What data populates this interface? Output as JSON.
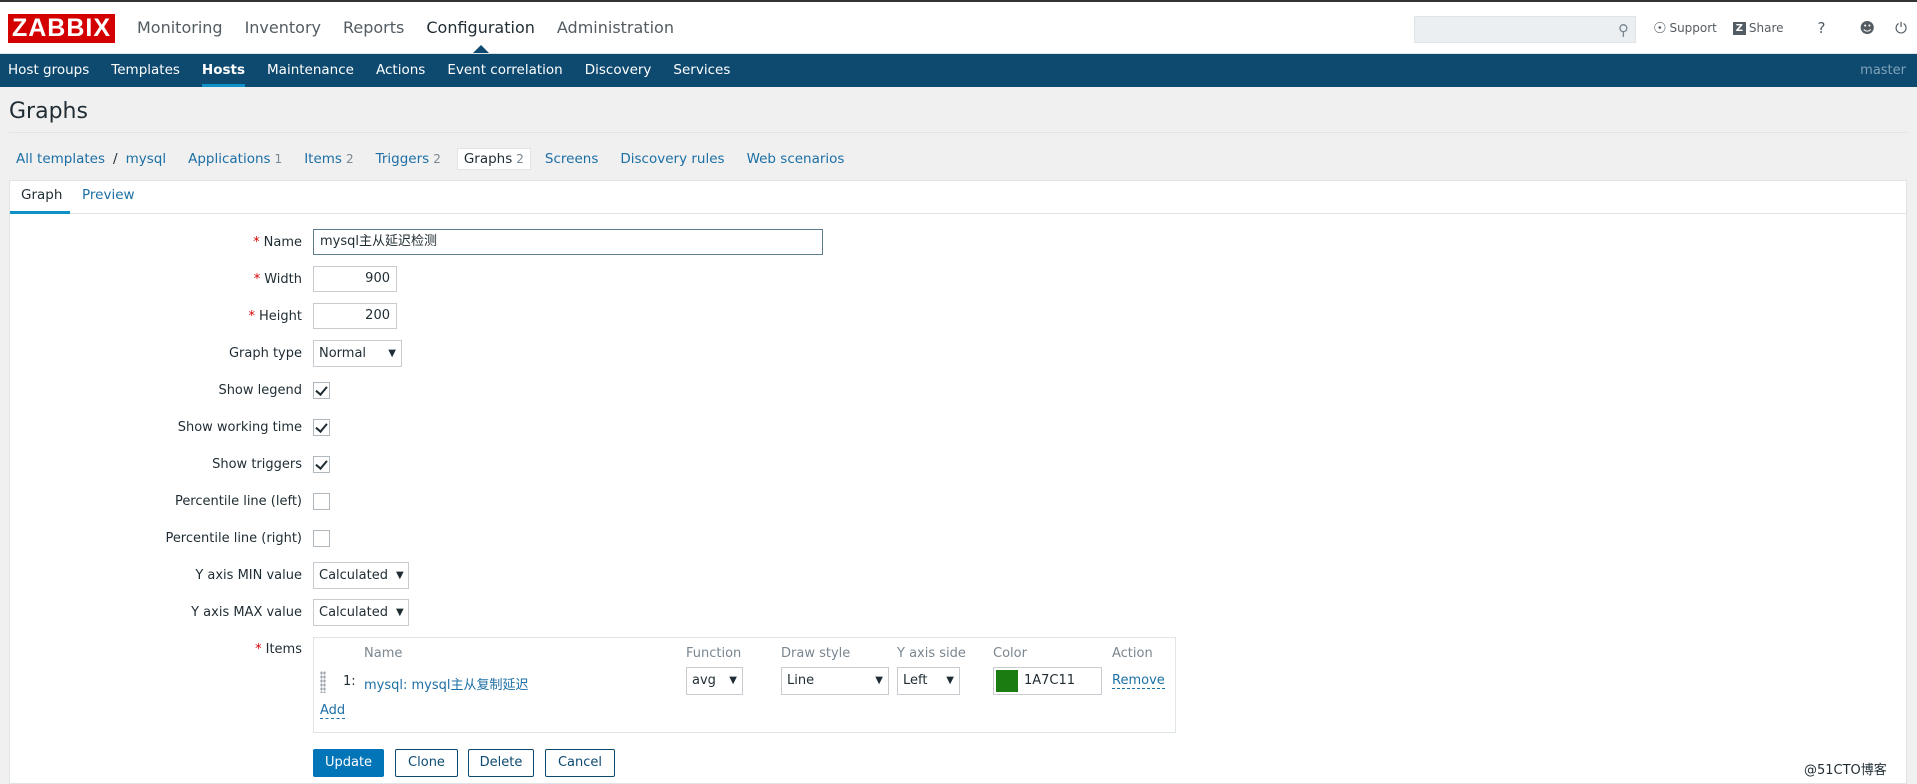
{
  "brand": {
    "logo": "ZABBIX",
    "accent": "#d40000",
    "nav_bg": "#0e4a70"
  },
  "main_menu": [
    "Monitoring",
    "Inventory",
    "Reports",
    "Configuration",
    "Administration"
  ],
  "top_links": {
    "support": "Support",
    "share": "Share",
    "help": "?"
  },
  "sub_menu": [
    "Host groups",
    "Templates",
    "Hosts",
    "Maintenance",
    "Actions",
    "Event correlation",
    "Discovery",
    "Services"
  ],
  "server_name": "master",
  "page_title": "Graphs",
  "breadcrumbs": {
    "all_templates": "All templates",
    "separator": "/",
    "host": "mysql",
    "applications": {
      "label": "Applications",
      "count": "1"
    },
    "items": {
      "label": "Items",
      "count": "2"
    },
    "triggers": {
      "label": "Triggers",
      "count": "2"
    },
    "graphs": {
      "label": "Graphs",
      "count": "2"
    },
    "screens": "Screens",
    "discovery_rules": "Discovery rules",
    "web_scenarios": "Web scenarios"
  },
  "tabs": [
    "Graph",
    "Preview"
  ],
  "form": {
    "name_label": "Name",
    "name_value": "mysql主从延迟检测",
    "width_label": "Width",
    "width_value": "900",
    "height_label": "Height",
    "height_value": "200",
    "graph_type_label": "Graph type",
    "graph_type_value": "Normal",
    "show_legend_label": "Show legend",
    "show_working_time_label": "Show working time",
    "show_triggers_label": "Show triggers",
    "percentile_left_label": "Percentile line (left)",
    "percentile_right_label": "Percentile line (right)",
    "y_min_label": "Y axis MIN value",
    "y_min_value": "Calculated",
    "y_max_label": "Y axis MAX value",
    "y_max_value": "Calculated",
    "items_label": "Items",
    "required_mark": "*"
  },
  "items_table": {
    "headers": [
      "Name",
      "Function",
      "Draw style",
      "Y axis side",
      "Color",
      "Action"
    ],
    "rows": [
      {
        "num": "1:",
        "name": "mysql: mysql主从复制延迟",
        "function": "avg",
        "draw_style": "Line",
        "y_axis_side": "Left",
        "color": "1A7C11",
        "color_hex": "#1a7c11",
        "action": "Remove"
      }
    ],
    "add_label": "Add"
  },
  "buttons": {
    "update": "Update",
    "clone": "Clone",
    "delete": "Delete",
    "cancel": "Cancel"
  },
  "watermark": "@51CTO博客"
}
